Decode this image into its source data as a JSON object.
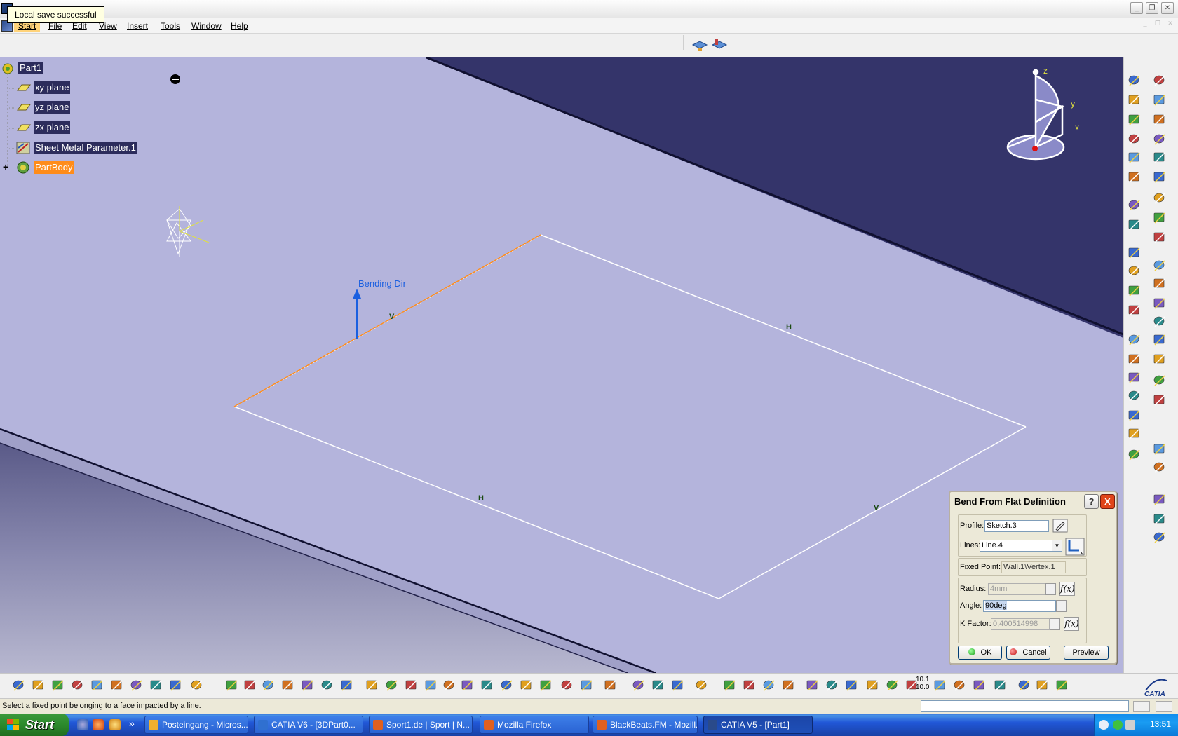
{
  "tooltip": {
    "text": "Local save successful"
  },
  "menu": {
    "start": "Start",
    "file": "File",
    "edit": "Edit",
    "view": "View",
    "insert": "Insert",
    "tools": "Tools",
    "window": "Window",
    "help": "Help"
  },
  "tree": {
    "root": "Part1",
    "items": [
      {
        "label": "xy plane"
      },
      {
        "label": "yz plane"
      },
      {
        "label": "zx plane"
      },
      {
        "label": "Sheet Metal Parameter.1"
      },
      {
        "label": "PartBody"
      }
    ],
    "expand_symbol": "+"
  },
  "viewport": {
    "bending_dir_label": "Bending Dir",
    "constraint_v": "V",
    "constraint_h": "H",
    "axis_x": "x",
    "axis_y": "y",
    "axis_z": "z",
    "colors": {
      "background": "#b4b4dc",
      "floor": "#34346a",
      "profile": "#ffffff",
      "selected_edge": "#ff8c1a",
      "arrow": "#1a5fe0"
    }
  },
  "dialog": {
    "title": "Bend From Flat Definition",
    "help_button": "?",
    "close_button": "X",
    "profile_label": "Profile:",
    "profile_value": "Sketch.3",
    "lines_label": "Lines:",
    "lines_value": "Line.4",
    "fixed_point_label": "Fixed Point:",
    "fixed_point_value": "Wall.1\\Vertex.1",
    "radius_label": "Radius:",
    "radius_value": "4mm",
    "angle_label": "Angle:",
    "angle_value": "90deg",
    "kfactor_label": "K Factor:",
    "kfactor_value": "0,400514998",
    "fx_label": "f(x)",
    "ok": "OK",
    "cancel": "Cancel",
    "preview": "Preview"
  },
  "bottom": {
    "catia_logo": "CATIA",
    "counter_top": "10.1",
    "counter_bottom": "10.0"
  },
  "status": {
    "message": "Select a fixed point belonging to a face impacted by a line."
  },
  "taskbar": {
    "start": "Start",
    "more": "»",
    "tasks": [
      {
        "label": "Posteingang - Micros...",
        "icon_color": "#f0b030"
      },
      {
        "label": "CATIA V6 - [3DPart0...",
        "icon_color": "#3070d0"
      },
      {
        "label": "Sport1.de | Sport | N...",
        "icon_color": "#e06020"
      },
      {
        "label": "Mozilla Firefox",
        "icon_color": "#e06020"
      },
      {
        "label": "BlackBeats.FM - Mozill...",
        "icon_color": "#e06020"
      },
      {
        "label": "CATIA V5 - [Part1]",
        "icon_color": "#2a4a8a"
      }
    ],
    "clock": "13:51"
  }
}
